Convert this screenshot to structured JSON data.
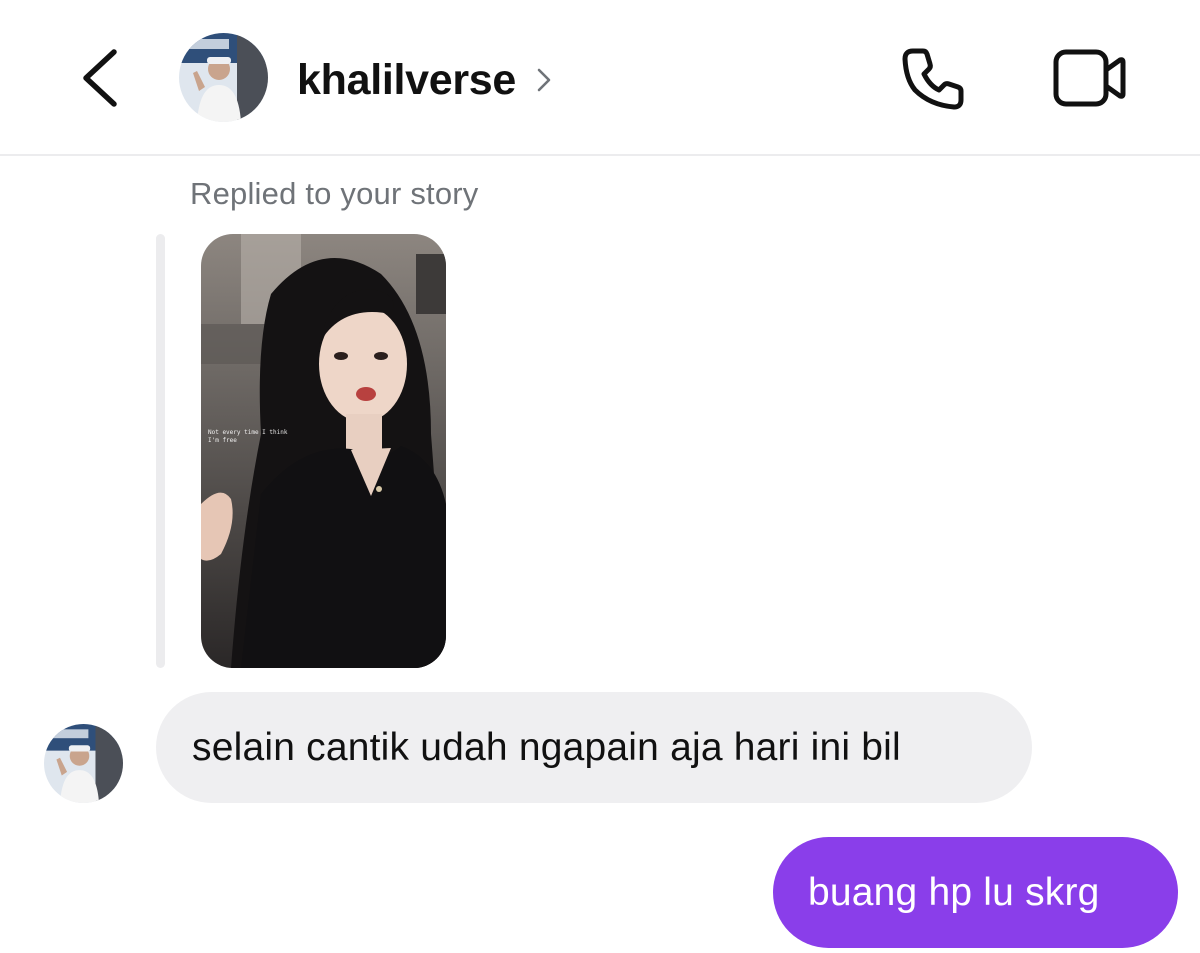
{
  "header": {
    "username": "khalilverse",
    "back_icon": "chevron-left-icon",
    "profile_chevron_icon": "chevron-right-icon",
    "call_icon": "phone-icon",
    "video_icon": "video-camera-icon"
  },
  "story_reply": {
    "label": "Replied to your story",
    "story_overlay_text": "Not every time I think I'm free"
  },
  "messages": [
    {
      "direction": "incoming",
      "text": "selain cantik udah ngapain aja hari ini bil"
    },
    {
      "direction": "outgoing",
      "text": "buang hp lu skrg"
    }
  ],
  "colors": {
    "outgoing_bubble": "#8a3eea",
    "incoming_bubble": "#efeff1",
    "secondary_text": "#6f7378",
    "divider": "#ececee"
  }
}
